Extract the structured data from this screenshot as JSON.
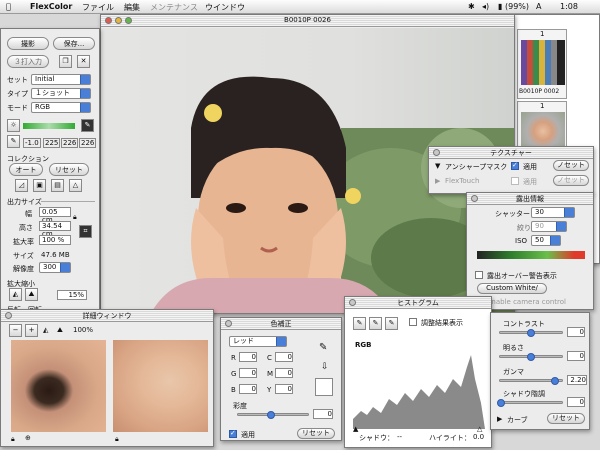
{
  "menubar": {
    "app": "FlexColor",
    "items": [
      "ファイル",
      "編集",
      "メンテナンス",
      "ウインドウ"
    ],
    "battery": "(99%)",
    "time": "1:08"
  },
  "main": {
    "title": "B0010P 0026"
  },
  "controls": {
    "scan": "撮影",
    "save": "保存...",
    "input": "３打入力",
    "set_label": "セット",
    "set_value": "Initial",
    "type_label": "タイプ",
    "type_value": "１ショット",
    "mode_label": "モード",
    "mode_value": "RGB",
    "levels": [
      "-1.0",
      "225",
      "226",
      "226"
    ],
    "collection_title": "コレクション",
    "auto": "オート",
    "reset": "リセット",
    "output_title": "出力サイズ",
    "width_label": "幅",
    "width_value": "0.05 cm",
    "height_label": "高さ",
    "height_value": "34.54 cm",
    "scale_label": "拡大率",
    "scale_value": "100 %",
    "size_label": "サイズ",
    "size_value": "47.6 MB",
    "res_label": "解像度",
    "res_value": "300",
    "zoom_title": "拡大縮小",
    "zoom_value": "15%",
    "rotate_title": "反転・回転"
  },
  "thumbnails": {
    "thumb1_num": "1",
    "thumb1_label": "B0010P 0002",
    "thumb2_num": "1"
  },
  "texture": {
    "title": "テクスチャー",
    "unsharp": "アンシャープマスク",
    "apply": "適用",
    "settings": "ノセット",
    "flextouch": "FlexTouch",
    "apply2": "適用",
    "settings2": "ノセット"
  },
  "exposure": {
    "title": "露出情報",
    "shutter_label": "シャッター",
    "shutter_value": "30",
    "aperture_label": "絞り",
    "aperture_value": "90",
    "iso_label": "ISO",
    "iso_value": "50",
    "warning": "露出オーバー警告表示",
    "custom_white": "Custom White/",
    "enable_camera": "Enable camera control"
  },
  "detail": {
    "title": "詳細ウィンドウ",
    "zoom": "100%"
  },
  "color": {
    "title": "色補正",
    "preset": "レッド",
    "rows": [
      [
        "R",
        "C"
      ],
      [
        "G",
        "M"
      ],
      [
        "B",
        "Y"
      ]
    ],
    "values": [
      "0",
      "0",
      "0",
      "0",
      "0",
      "0"
    ],
    "saturation_label": "彩度",
    "saturation_value": "0",
    "apply": "適用",
    "reset": "リセット"
  },
  "histogram": {
    "title": "ヒストグラム",
    "adjust_display": "調整結果表示",
    "channel": "RGB",
    "shadow_label": "シャドウ：",
    "shadow_value": "--",
    "highlight_label": "ハイライト：",
    "highlight_value": "0.0"
  },
  "curves": {
    "contrast_label": "コントラスト",
    "contrast_value": "0",
    "brightness_label": "明るさ",
    "brightness_value": "0",
    "gamma_label": "ガンマ",
    "gamma_value": "2.20",
    "shadow_label": "シャドウ階調",
    "shadow_value": "0",
    "curve_label": "カーブ",
    "reset": "リセット"
  }
}
